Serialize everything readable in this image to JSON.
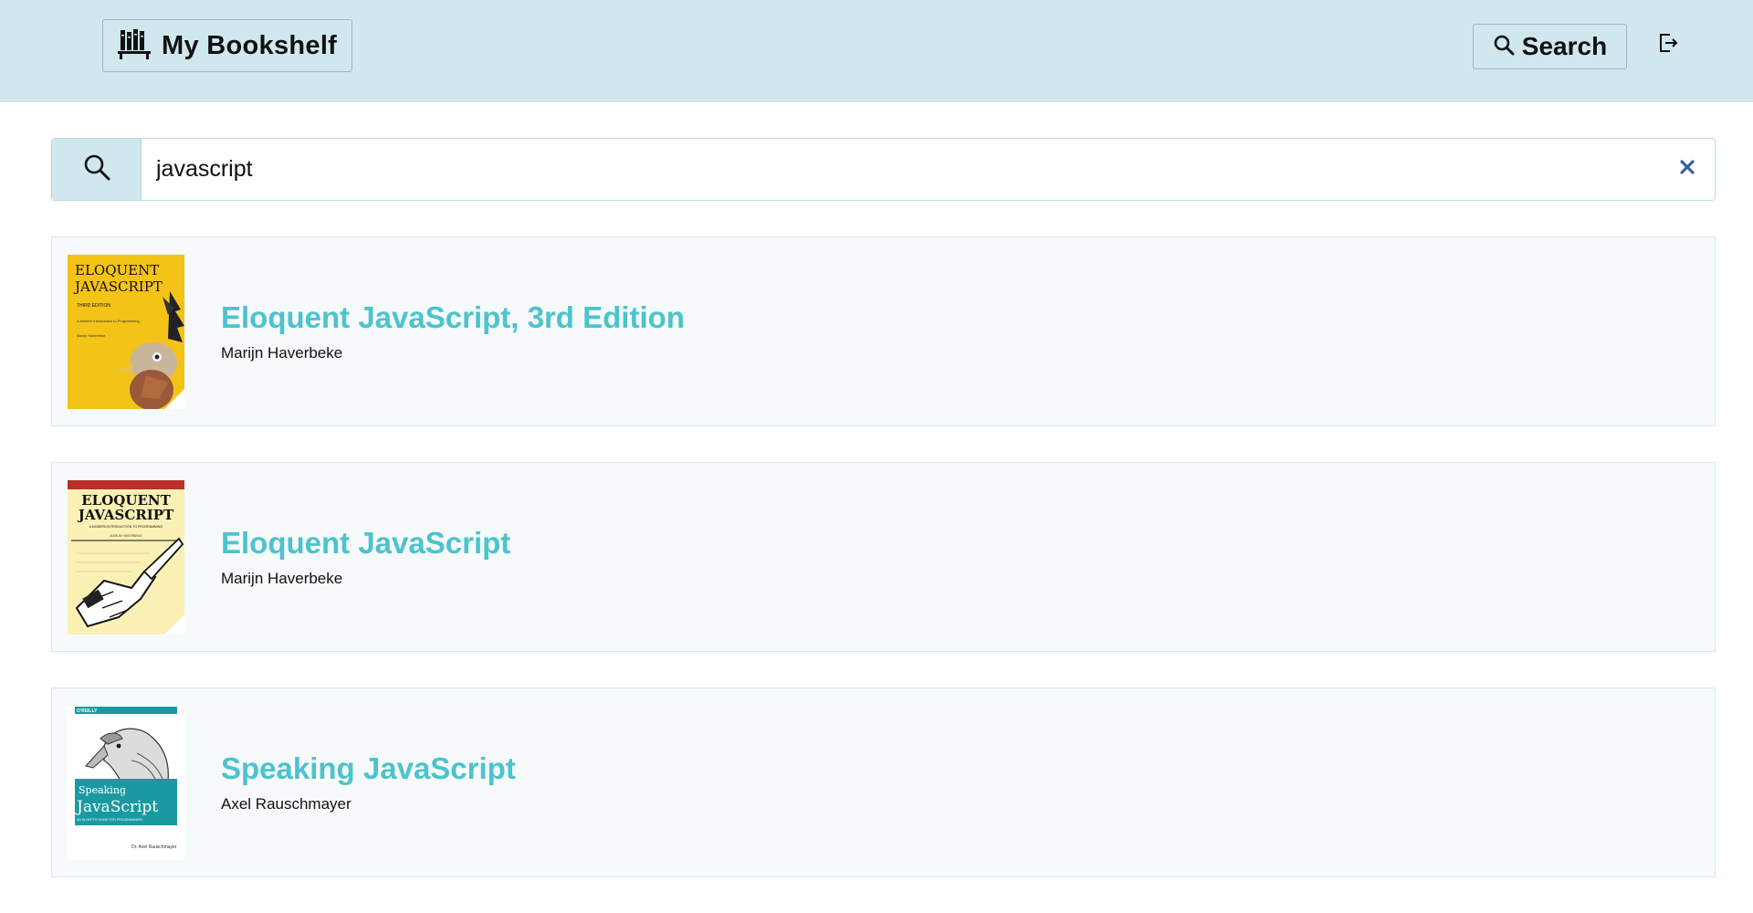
{
  "header": {
    "brand_label": "My Bookshelf",
    "search_label": "Search",
    "colors": {
      "background": "#d0e7ee",
      "border": "#9fb8c0"
    },
    "icons": {
      "brand": "bookshelf-icon",
      "search": "search-icon",
      "logout": "logout-icon"
    }
  },
  "search": {
    "value": "javascript",
    "icons": {
      "search": "search-icon",
      "clear": "close-icon"
    },
    "colors": {
      "clear": "#3a5fa0"
    }
  },
  "results": [
    {
      "title": "Eloquent JavaScript, 3rd Edition",
      "author": "Marijn Haverbeke",
      "cover": {
        "title_line1": "ELOQUENT",
        "title_line2": "JAVASCRIPT",
        "subtitle": "THIRD EDITION",
        "tagline": "A Modern Introduction to Programming",
        "byline": "Marijn Haverbeke",
        "color": "#f4c318"
      }
    },
    {
      "title": "Eloquent JavaScript",
      "author": "Marijn Haverbeke",
      "cover": {
        "title_line1": "ELOQUENT",
        "title_line2": "JAVASCRIPT",
        "tagline": "A MODERN INTRODUCTION TO PROGRAMMING",
        "byline": "MARIJN HAVERBEKE",
        "color": "#fbf1b5"
      }
    },
    {
      "title": "Speaking JavaScript",
      "author": "Axel Rauschmayer",
      "cover": {
        "publisher": "O'REILLY",
        "title_line1": "Speaking",
        "title_line2": "JavaScript",
        "tagline": "AN IN-DEPTH GUIDE FOR PROGRAMMERS",
        "byline": "Dr. Axel Rauschmayer",
        "color": "#1a9aa0"
      }
    }
  ],
  "accent_color": "#4cc3cd"
}
